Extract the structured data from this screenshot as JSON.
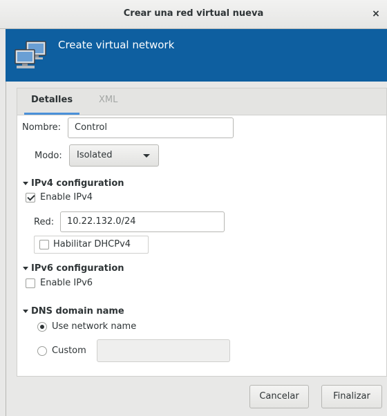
{
  "window": {
    "title": "Crear una red virtual nueva",
    "close_label": "×"
  },
  "banner": {
    "title": "Create virtual network",
    "icon": "network-computers-icon"
  },
  "tabs": [
    {
      "label": "Detalles",
      "active": true
    },
    {
      "label": "XML",
      "active": false
    }
  ],
  "form": {
    "name_label": "Nombre:",
    "name_value": "Control",
    "mode_label": "Modo:",
    "mode_value": "Isolated"
  },
  "ipv4": {
    "heading": "IPv4 configuration",
    "enable_label": "Enable IPv4",
    "enable_checked": true,
    "network_label": "Red:",
    "network_value": "10.22.132.0/24",
    "dhcp_label": "Habilitar DHCPv4",
    "dhcp_checked": false
  },
  "ipv6": {
    "heading": "IPv6 configuration",
    "enable_label": "Enable IPv6",
    "enable_checked": false
  },
  "dns": {
    "heading": "DNS domain name",
    "use_network_name_label": "Use network name",
    "use_network_name_selected": true,
    "custom_label": "Custom",
    "custom_value": ""
  },
  "footer": {
    "cancel_label": "Cancelar",
    "finish_label": "Finalizar"
  },
  "colors": {
    "banner": "#0e5fa0",
    "tab_underline": "#4a90d9",
    "window_bg": "#e8e8e7"
  }
}
